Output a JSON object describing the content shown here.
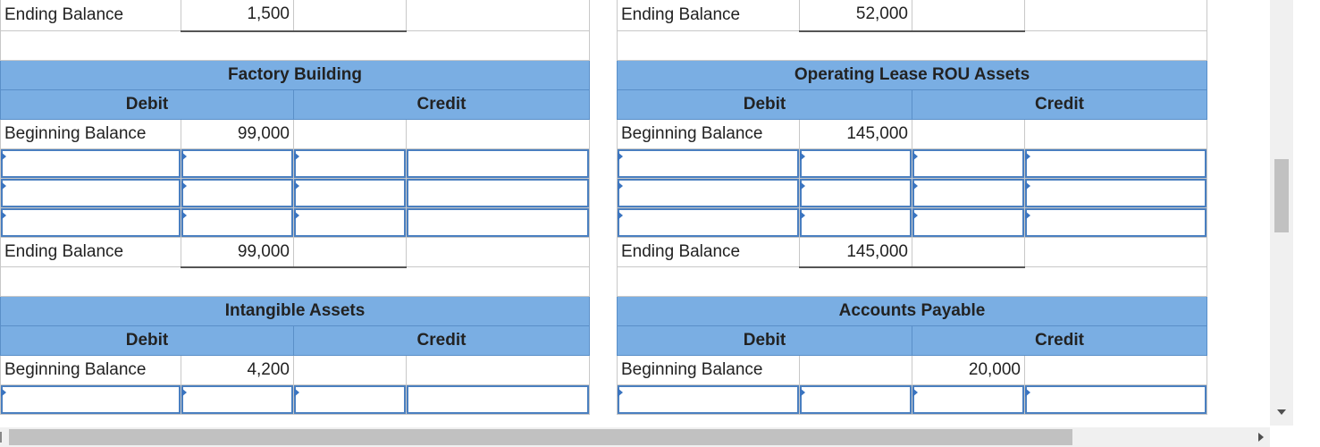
{
  "top_left": {
    "ending_label": "Ending Balance",
    "ending_value": "1,500"
  },
  "top_right": {
    "ending_label": "Ending Balance",
    "ending_value": "52,000"
  },
  "factory_building": {
    "title": "Factory Building",
    "debit_label": "Debit",
    "credit_label": "Credit",
    "beginning_label": "Beginning Balance",
    "beginning_value": "99,000",
    "ending_label": "Ending Balance",
    "ending_value": "99,000"
  },
  "rou_assets": {
    "title": "Operating Lease ROU Assets",
    "debit_label": "Debit",
    "credit_label": "Credit",
    "beginning_label": "Beginning Balance",
    "beginning_value": "145,000",
    "ending_label": "Ending Balance",
    "ending_value": "145,000"
  },
  "intangible_assets": {
    "title": "Intangible Assets",
    "debit_label": "Debit",
    "credit_label": "Credit",
    "beginning_label": "Beginning Balance",
    "beginning_value": "4,200"
  },
  "accounts_payable": {
    "title": "Accounts Payable",
    "debit_label": "Debit",
    "credit_label": "Credit",
    "beginning_label": "Beginning Balance",
    "beginning_credit_value": "20,000"
  }
}
